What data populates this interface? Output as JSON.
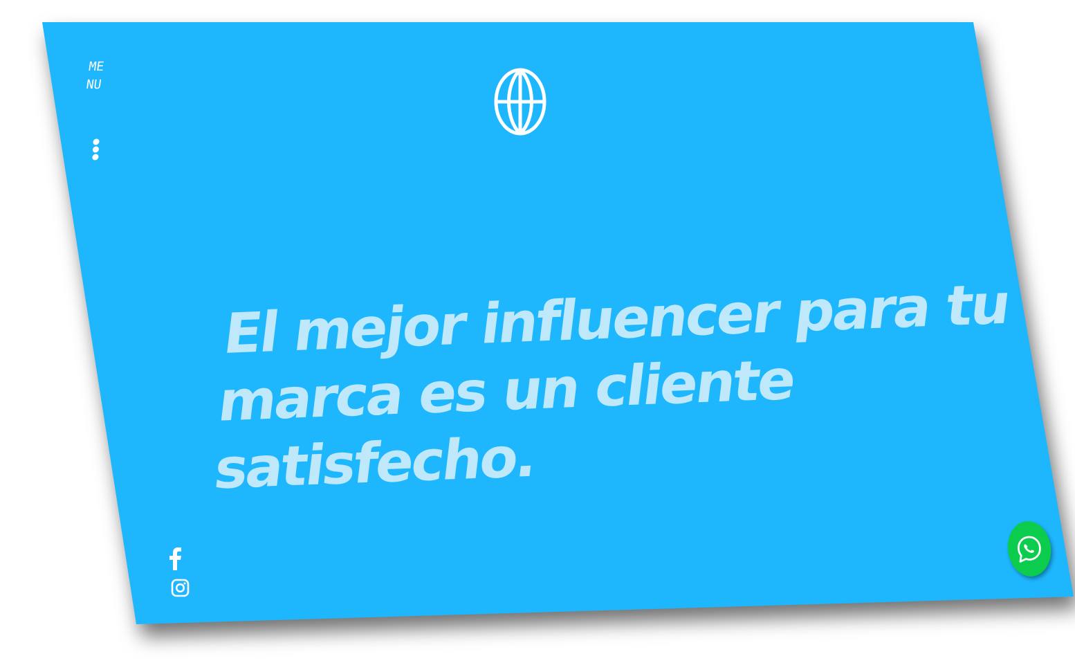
{
  "colors": {
    "panel_background": "#1eb7fe",
    "headline_text": "#bfe9fb",
    "icon_white": "#ffffff",
    "whatsapp_green": "#0ccc4d"
  },
  "menu": {
    "label": "MENU",
    "dots_icon": "vertical-dots-icon"
  },
  "logo": {
    "icon": "globe-icon"
  },
  "hero": {
    "headline_line1": "El mejor influencer para tu",
    "headline_line2": "marca es un cliente",
    "headline_line3": "satisfecho."
  },
  "social": {
    "facebook_icon": "facebook-icon",
    "instagram_icon": "instagram-icon"
  },
  "whatsapp": {
    "icon": "whatsapp-icon"
  }
}
